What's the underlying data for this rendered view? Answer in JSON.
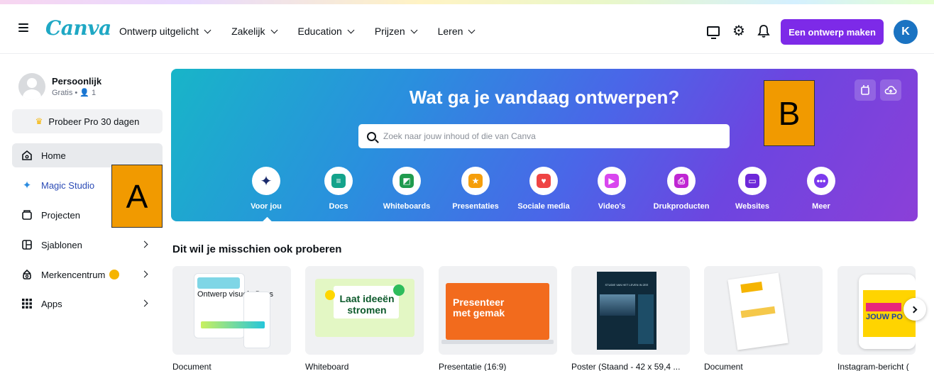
{
  "header": {
    "logo": "Canva",
    "nav": [
      "Ontwerp uitgelicht",
      "Zakelijk",
      "Education",
      "Prijzen",
      "Leren"
    ],
    "create_button": "Een ontwerp maken",
    "avatar_letter": "K"
  },
  "sidebar": {
    "profile_name": "Persoonlijk",
    "profile_sub": "Gratis • 👤 1",
    "pro_button": "Probeer Pro 30 dagen",
    "items": [
      {
        "label": "Home",
        "icon": "home-icon"
      },
      {
        "label": "Magic Studio",
        "icon": "sparkle-icon"
      },
      {
        "label": "Projecten",
        "icon": "folder-icon"
      },
      {
        "label": "Sjablonen",
        "icon": "template-icon"
      },
      {
        "label": "Merkencentrum",
        "icon": "brand-icon"
      },
      {
        "label": "Apps",
        "icon": "grid-icon"
      }
    ]
  },
  "labels": {
    "a": "A",
    "b": "B"
  },
  "hero": {
    "title": "Wat ga je vandaag ontwerpen?",
    "search_placeholder": "Zoek naar jouw inhoud of die van Canva",
    "categories": [
      {
        "label": "Voor jou",
        "icon": "sparkle-icon",
        "color": "#1a2a6c"
      },
      {
        "label": "Docs",
        "icon": "doc-icon",
        "color": "#14a38b"
      },
      {
        "label": "Whiteboards",
        "icon": "whiteboard-icon",
        "color": "#1f9b4e"
      },
      {
        "label": "Presentaties",
        "icon": "presentation-icon",
        "color": "#f59e0b"
      },
      {
        "label": "Sociale media",
        "icon": "heart-icon",
        "color": "#ef4444"
      },
      {
        "label": "Video's",
        "icon": "video-icon",
        "color": "#d946ef"
      },
      {
        "label": "Drukproducten",
        "icon": "print-icon",
        "color": "#c026d3"
      },
      {
        "label": "Websites",
        "icon": "website-icon",
        "color": "#6d28d9"
      },
      {
        "label": "Meer",
        "icon": "more-icon",
        "color": "#7c3aed"
      }
    ]
  },
  "suggestions": {
    "title": "Dit wil je misschien ook proberen",
    "cards": [
      {
        "label": "Document",
        "thumb_text": "Ontwerp visuele Docs"
      },
      {
        "label": "Whiteboard",
        "thumb_text": "Laat ideeën stromen"
      },
      {
        "label": "Presentatie (16:9)",
        "thumb_text": "Presenteer met gemak"
      },
      {
        "label": "Poster (Staand - 42 x 59,4 ...",
        "thumb_text": "STUDIE VAN HET LEVEN IN ZEE"
      },
      {
        "label": "Document",
        "thumb_text": ""
      },
      {
        "label": "Instagram-bericht (",
        "thumb_text": "JOUW PO"
      }
    ]
  }
}
